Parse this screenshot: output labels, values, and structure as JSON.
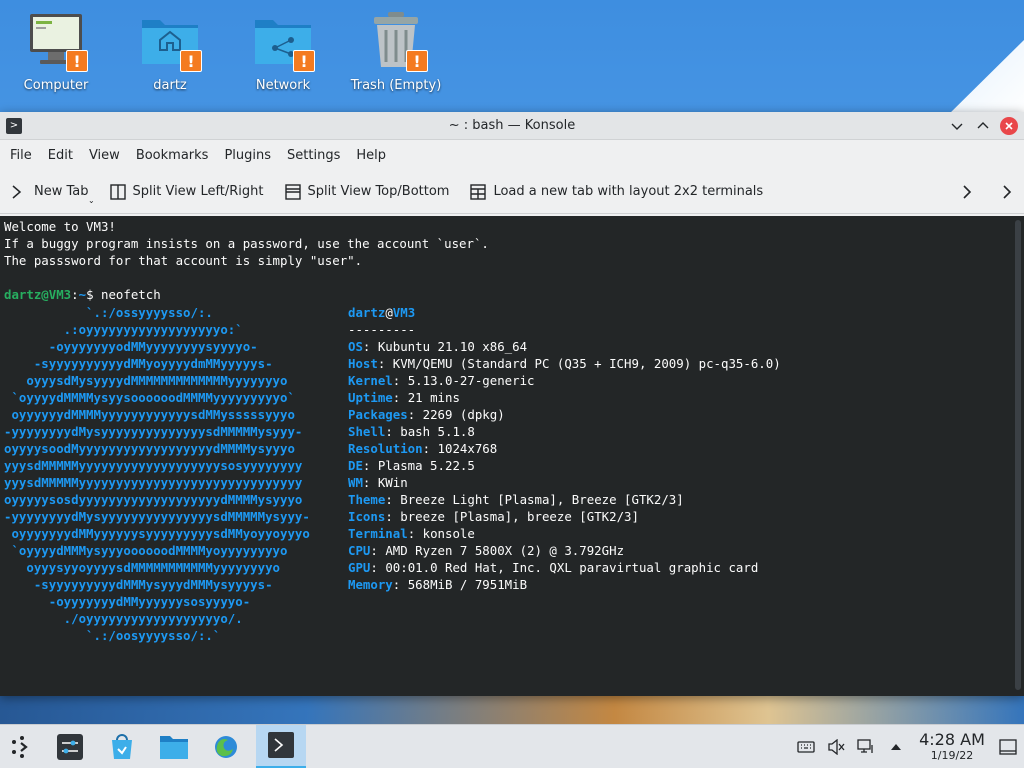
{
  "desktop": {
    "icons": [
      {
        "label": "Computer",
        "icon": "computer-icon"
      },
      {
        "label": "dartz",
        "icon": "home-folder-icon"
      },
      {
        "label": "Network",
        "icon": "network-folder-icon"
      },
      {
        "label": "Trash (Empty)",
        "icon": "trash-icon"
      }
    ],
    "badge": "!"
  },
  "window": {
    "title": "~ : bash — Konsole",
    "app_icon": "konsole-icon"
  },
  "menubar": [
    "File",
    "Edit",
    "View",
    "Bookmarks",
    "Plugins",
    "Settings",
    "Help"
  ],
  "toolbar": {
    "new_tab": "New Tab",
    "split_lr": "Split View Left/Right",
    "split_tb": "Split View Top/Bottom",
    "load_layout": "Load a new tab with layout 2x2 terminals"
  },
  "terminal": {
    "welcome": [
      "Welcome to VM3!",
      "If a buggy program insists on a password, use the account `user`.",
      "The passsword for that account is simply \"user\"."
    ],
    "prompt_user": "dartz@VM3",
    "prompt_sep": ":",
    "prompt_dir": "~",
    "prompt_end": "$ ",
    "command": "neofetch",
    "logo_lines": [
      "           `.:/ossyyyysso/:.",
      "        .:oyyyyyyyyyyyyyyyyyyo:`",
      "      -oyyyyyyyodMMyyyyyyyysyyyyo-",
      "    -syyyyyyyyyydMMyoyyyydmMMyyyyys-",
      "   oyyysdMysyyyydMMMMMMMMMMMMMyyyyyyyo",
      " `oyyyydMMMMysyysoooooodMMMMyyyyyyyyyo`",
      " oyyyyyydMMMMyyyyyyyyyyyysdMMysssssyyyo",
      "-yyyyyyyydMysyyyyyyyyyyyyyysdMMMMMysyyy-",
      "oyyyysoodMyyyyyyyyyyyyyyyyyydMMMMysyyyo",
      "yyysdMMMMMyyyyyyyyyyyyyyyyyyysosyyyyyyyy",
      "yyysdMMMMMyyyyyyyyyyyyyyyyyyyyyyyyyyyyyy",
      "oyyyyysosdyyyyyyyyyyyyyyyyyyydMMMMysyyyo",
      "-yyyyyyyydMysyyyyyyyyyyyyyyysdMMMMMysyyy-",
      " oyyyyyyydMMyyyyyysyyyyyyyyysdMMyoyyoyyyo",
      " `oyyyydMMMysyyyoooooodMMMMyoyyyyyyyyo",
      "   oyyysyyoyyyysdMMMMMMMMMMMyyyyyyyyo",
      "    -syyyyyyyyydMMMysyyydMMMysyyyys-",
      "      -oyyyyyyydMMyyyyyysosyyyyo-",
      "        ./oyyyyyyyyyyyyyyyyyyo/.",
      "           `.:/oosyyyysso/:.`"
    ],
    "neofetch": {
      "user": "dartz",
      "at": "@",
      "host": "VM3",
      "divider": "---------",
      "fields": [
        {
          "key": "OS",
          "value": "Kubuntu 21.10 x86_64"
        },
        {
          "key": "Host",
          "value": "KVM/QEMU (Standard PC (Q35 + ICH9, 2009) pc-q35-6.0)"
        },
        {
          "key": "Kernel",
          "value": "5.13.0-27-generic"
        },
        {
          "key": "Uptime",
          "value": "21 mins"
        },
        {
          "key": "Packages",
          "value": "2269 (dpkg)"
        },
        {
          "key": "Shell",
          "value": "bash 5.1.8"
        },
        {
          "key": "Resolution",
          "value": "1024x768"
        },
        {
          "key": "DE",
          "value": "Plasma 5.22.5"
        },
        {
          "key": "WM",
          "value": "KWin"
        },
        {
          "key": "Theme",
          "value": "Breeze Light [Plasma], Breeze [GTK2/3]"
        },
        {
          "key": "Icons",
          "value": "breeze [Plasma], breeze [GTK2/3]"
        },
        {
          "key": "Terminal",
          "value": "konsole"
        },
        {
          "key": "CPU",
          "value": "AMD Ryzen 7 5800X (2) @ 3.792GHz"
        },
        {
          "key": "GPU",
          "value": "00:01.0 Red Hat, Inc. QXL paravirtual graphic card"
        },
        {
          "key": "Memory",
          "value": "568MiB / 7951MiB"
        }
      ],
      "palette_top": [
        "#232627",
        "#ed1515",
        "#11d116",
        "#f67400",
        "#1d99f3",
        "#9b59b6",
        "#1abc9c",
        "#fcfcfc"
      ],
      "palette_bottom": [
        "#7f8c8d",
        "#c0392b",
        "#1cdc9a",
        "#fdbc4b",
        "#3daee9",
        "#8e44ad",
        "#16a085",
        "#ffffff"
      ]
    }
  },
  "taskbar": {
    "apps": [
      "app-launcher-icon",
      "system-settings-icon",
      "discover-icon",
      "dolphin-icon",
      "firefox-icon",
      "konsole-icon"
    ],
    "tray": [
      "keyboard-icon",
      "volume-muted-icon",
      "network-icon",
      "expand-tray-icon"
    ],
    "time": "4:28 AM",
    "date": "1/19/22"
  }
}
